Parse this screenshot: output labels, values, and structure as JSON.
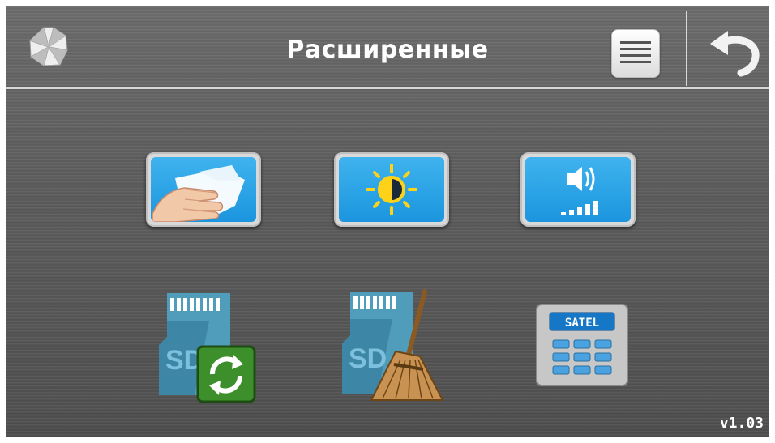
{
  "header": {
    "title": "Расширенные"
  },
  "sd_icon_text": "SD",
  "keypad": {
    "brand": "SATEL"
  },
  "footer": {
    "version": "v1.03"
  },
  "colors": {
    "tile_blue": "#2aa3e8",
    "refresh_green": "#3c8f2a",
    "keypad_brand_blue": "#1677c7"
  },
  "icons": [
    "logo-icon",
    "menu-icon",
    "back-icon",
    "screen-cleaning-icon",
    "brightness-icon",
    "volume-icon",
    "sd-card-update-icon",
    "sd-card-clean-icon",
    "keypad-satel-icon"
  ]
}
